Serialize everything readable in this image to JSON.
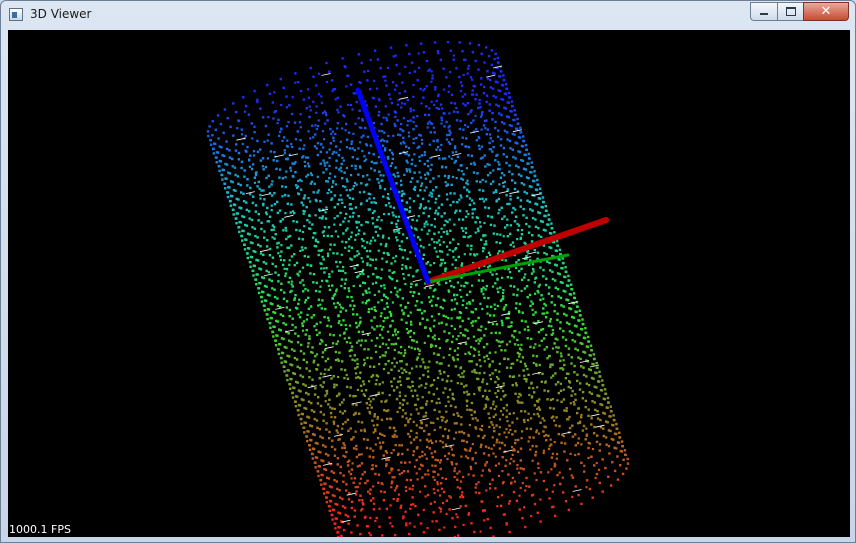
{
  "window": {
    "title": "3D Viewer"
  },
  "controls": {
    "close": "✕"
  },
  "status": {
    "fps": "1000.1 FPS"
  },
  "scene": {
    "background": "#000000",
    "axes": [
      {
        "name": "x",
        "color": "#c00000"
      },
      {
        "name": "y",
        "color": "#00a000"
      },
      {
        "name": "z",
        "color": "#0000ff"
      }
    ],
    "point_cloud": {
      "shape": "cylinder",
      "color_gradient": [
        "#1a2cff",
        "#19c6c0",
        "#2fe03a",
        "#a07a20",
        "#ff1a1a"
      ]
    }
  }
}
